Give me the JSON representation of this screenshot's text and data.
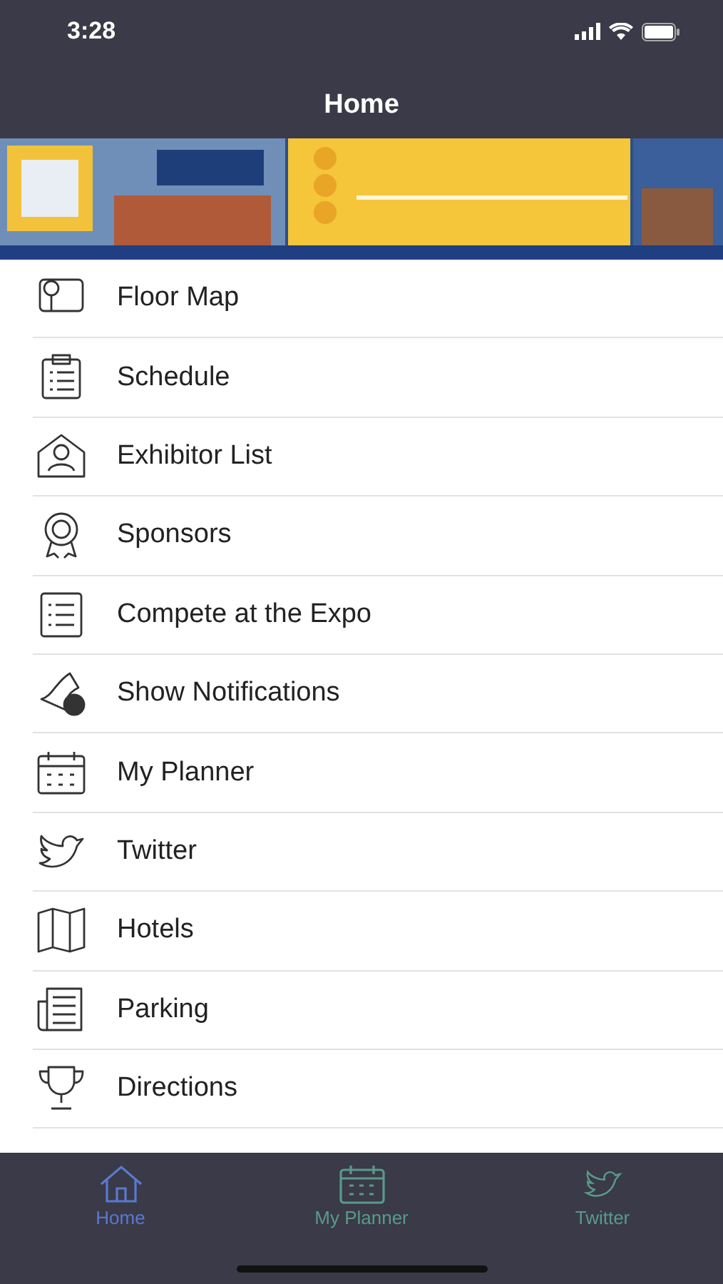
{
  "status_bar": {
    "time": "3:28"
  },
  "nav": {
    "title": "Home"
  },
  "menu": [
    {
      "label": "Floor Map"
    },
    {
      "label": "Schedule"
    },
    {
      "label": "Exhibitor List"
    },
    {
      "label": "Sponsors"
    },
    {
      "label": "Compete at the Expo"
    },
    {
      "label": "Show Notifications"
    },
    {
      "label": "My Planner"
    },
    {
      "label": "Twitter"
    },
    {
      "label": "Hotels"
    },
    {
      "label": "Parking"
    },
    {
      "label": "Directions"
    }
  ],
  "tab_bar": [
    {
      "label": "Home",
      "selected": true
    },
    {
      "label": "My Planner",
      "selected": false
    },
    {
      "label": "Twitter",
      "selected": false
    }
  ]
}
